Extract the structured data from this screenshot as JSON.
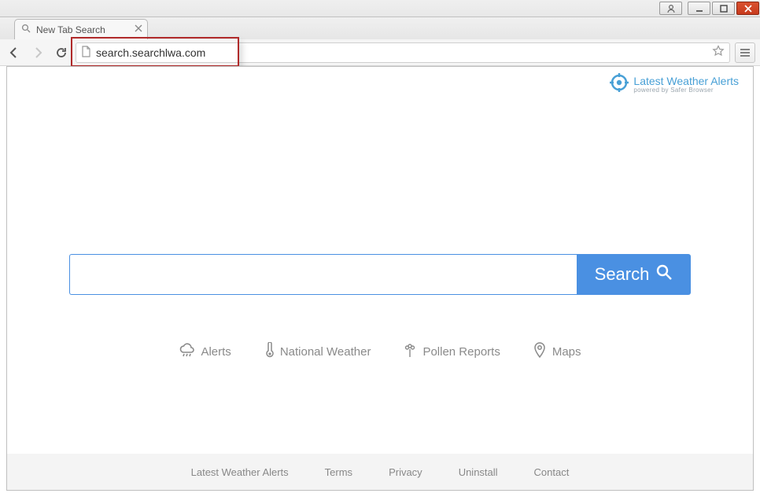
{
  "window": {
    "tab_title": "New Tab Search"
  },
  "urlbar": {
    "url": "search.searchlwa.com"
  },
  "brand": {
    "title": "Latest Weather Alerts",
    "subtitle": "powered by Safer Browser"
  },
  "search": {
    "button_label": "Search",
    "input_value": ""
  },
  "quick_links": [
    {
      "label": "Alerts"
    },
    {
      "label": "National Weather"
    },
    {
      "label": "Pollen Reports"
    },
    {
      "label": "Maps"
    }
  ],
  "footer": [
    "Latest Weather Alerts",
    "Terms",
    "Privacy",
    "Uninstall",
    "Contact"
  ]
}
